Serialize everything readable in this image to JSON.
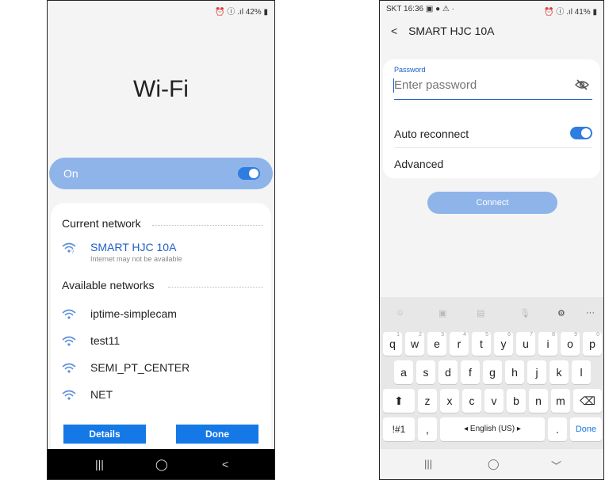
{
  "left_phone": {
    "status": {
      "right": "⏰ ⓘ .ıl 42% ▮"
    },
    "title": "Wi-Fi",
    "on_label": "On",
    "current_network_header": "Current network",
    "current_network": {
      "name": "SMART HJC 10A",
      "sub": "Internet may not be available"
    },
    "available_header": "Available networks",
    "networks": [
      "iptime-simplecam",
      "test11",
      "SEMI_PT_CENTER",
      "NET"
    ],
    "details_label": "Details",
    "done_label": "Done",
    "nav": {
      "recents": "|||",
      "home": "◯",
      "back": "<"
    }
  },
  "right_phone": {
    "status": {
      "left": "SKT 16:36 ▣ ● ⚠ ·",
      "right": "⏰ ⓘ .ıl 41% ▮"
    },
    "header_title": "SMART HJC 10A",
    "password_label": "Password",
    "password_placeholder": "Enter password",
    "auto_reconnect_label": "Auto reconnect",
    "advanced_label": "Advanced",
    "connect_label": "Connect",
    "kb_row1": [
      {
        "k": "q",
        "h": "1"
      },
      {
        "k": "w",
        "h": "2"
      },
      {
        "k": "e",
        "h": "3"
      },
      {
        "k": "r",
        "h": "4"
      },
      {
        "k": "t",
        "h": "5"
      },
      {
        "k": "y",
        "h": "6"
      },
      {
        "k": "u",
        "h": "7"
      },
      {
        "k": "i",
        "h": "8"
      },
      {
        "k": "o",
        "h": "9"
      },
      {
        "k": "p",
        "h": "0"
      }
    ],
    "kb_row2": [
      "a",
      "s",
      "d",
      "f",
      "g",
      "h",
      "j",
      "k",
      "l"
    ],
    "kb_row3": [
      "z",
      "x",
      "c",
      "v",
      "b",
      "n",
      "m"
    ],
    "kb_sym": "!#1",
    "kb_comma": ",",
    "kb_space": "◂ English (US) ▸",
    "kb_period": ".",
    "kb_done": "Done",
    "kb_nav": {
      "recents": "|||",
      "home": "◯",
      "down": "﹀"
    }
  },
  "colors": {
    "accent": "#1478e6",
    "toggle_on": "#2f7de1",
    "on_bar": "#8fb4e9",
    "current_network": "#1e5fc8"
  }
}
